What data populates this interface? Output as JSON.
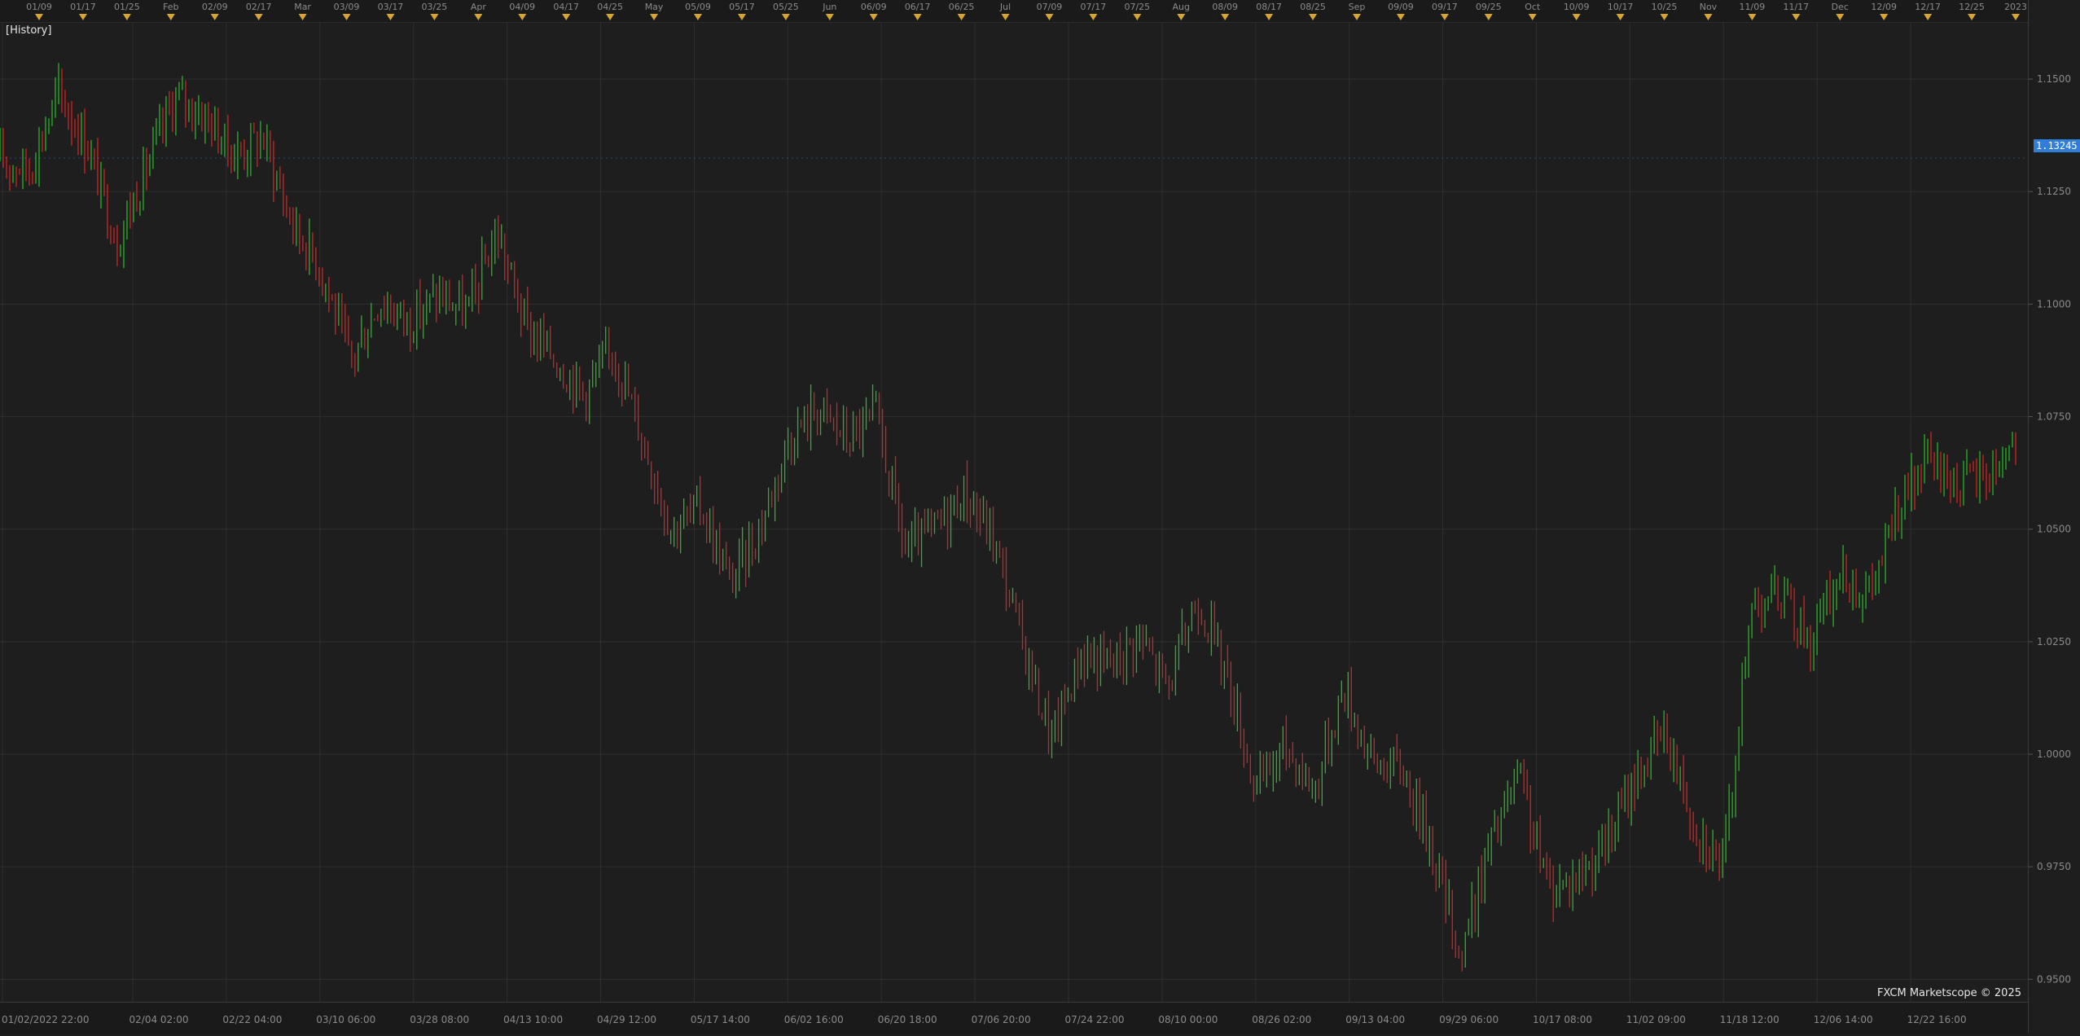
{
  "window": {
    "history_label": "[History]",
    "copyright": "FXCM Marketscope © 2025",
    "current_price": "1.13245"
  },
  "colors": {
    "background": "#1e1e1e",
    "grid": "#2e2e2e",
    "up_candle": "#22b822",
    "down_candle": "#d82020",
    "axis_text": "#8a8a8a",
    "marker": "#d7a531",
    "price_badge": "#2f7fd8"
  },
  "top_axis_labels": [
    "01/09",
    "01/17",
    "01/25",
    "Feb",
    "02/09",
    "02/17",
    "Mar",
    "03/09",
    "03/17",
    "03/25",
    "Apr",
    "04/09",
    "04/17",
    "04/25",
    "May",
    "05/09",
    "05/17",
    "05/25",
    "Jun",
    "06/09",
    "06/17",
    "06/25",
    "Jul",
    "07/09",
    "07/17",
    "07/25",
    "Aug",
    "08/09",
    "08/17",
    "08/25",
    "Sep",
    "09/09",
    "09/17",
    "09/25",
    "Oct",
    "10/09",
    "10/17",
    "10/25",
    "Nov",
    "11/09",
    "11/17",
    "Dec",
    "12/09",
    "12/17",
    "12/25",
    "2023"
  ],
  "chart_data": {
    "type": "line",
    "title": "",
    "xlabel": "",
    "ylabel": "",
    "ylim": [
      0.945,
      1.1625
    ],
    "grid": true,
    "y_ticks": [
      "1.1500",
      "1.1250",
      "1.1000",
      "1.0750",
      "1.0500",
      "1.0250",
      "1.0000",
      "0.9750",
      "0.9500"
    ],
    "y_tick_values": [
      1.15,
      1.125,
      1.1,
      1.075,
      1.05,
      1.025,
      1.0,
      0.975,
      0.95
    ],
    "x_tick_labels": [
      "01/02/2022 22:00",
      "02/04 02:00",
      "02/22 04:00",
      "03/10 06:00",
      "03/28 08:00",
      "04/13 10:00",
      "04/29 12:00",
      "05/17 14:00",
      "06/02 16:00",
      "06/20 18:00",
      "07/06 20:00",
      "07/24 22:00",
      "08/10 00:00",
      "08/26 02:00",
      "09/13 04:00",
      "09/29 06:00",
      "10/17 08:00",
      "11/02 09:00",
      "11/18 12:00",
      "12/06 14:00",
      "12/22 16:00"
    ],
    "series": [
      {
        "style": "candles",
        "x": [
          "2022-01-02",
          "2022-01-09",
          "2022-01-13",
          "2022-01-20",
          "2022-01-27",
          "2022-02-01",
          "2022-02-05",
          "2022-02-10",
          "2022-02-15",
          "2022-02-20",
          "2022-02-26",
          "2022-03-02",
          "2022-03-08",
          "2022-03-12",
          "2022-03-16",
          "2022-03-20",
          "2022-03-25",
          "2022-03-30",
          "2022-04-04",
          "2022-04-10",
          "2022-04-15",
          "2022-04-21",
          "2022-04-26",
          "2022-05-02",
          "2022-05-08",
          "2022-05-12",
          "2022-05-18",
          "2022-05-25",
          "2022-05-31",
          "2022-06-06",
          "2022-06-10",
          "2022-06-15",
          "2022-06-19",
          "2022-06-25",
          "2022-06-30",
          "2022-07-07",
          "2022-07-13",
          "2022-07-17",
          "2022-07-23",
          "2022-07-29",
          "2022-08-03",
          "2022-08-10",
          "2022-08-13",
          "2022-08-20",
          "2022-08-27",
          "2022-09-02",
          "2022-09-10",
          "2022-09-13",
          "2022-09-18",
          "2022-09-23",
          "2022-09-28",
          "2022-10-02",
          "2022-10-06",
          "2022-10-10",
          "2022-10-14",
          "2022-10-20",
          "2022-10-26",
          "2022-11-01",
          "2022-11-05",
          "2022-11-09",
          "2022-11-12",
          "2022-11-18",
          "2022-11-25",
          "2022-11-30",
          "2022-12-05",
          "2022-12-09",
          "2022-12-15",
          "2022-12-20",
          "2022-12-26",
          "2022-12-30"
        ],
        "values": [
          1.132,
          1.13,
          1.147,
          1.135,
          1.114,
          1.13,
          1.146,
          1.142,
          1.133,
          1.137,
          1.118,
          1.108,
          1.087,
          1.101,
          1.096,
          1.102,
          1.098,
          1.116,
          1.095,
          1.088,
          1.08,
          1.09,
          1.07,
          1.05,
          1.055,
          1.038,
          1.05,
          1.07,
          1.077,
          1.07,
          1.075,
          1.045,
          1.05,
          1.058,
          1.048,
          1.025,
          1.003,
          1.022,
          1.02,
          1.026,
          1.015,
          1.035,
          1.018,
          0.992,
          1.002,
          0.992,
          1.015,
          0.998,
          0.997,
          0.98,
          0.955,
          0.98,
          0.995,
          0.97,
          0.973,
          0.98,
          0.995,
          1.005,
          0.985,
          0.975,
          1.035,
          1.035,
          1.025,
          1.04,
          1.035,
          1.055,
          1.065,
          1.06,
          1.062,
          1.07
        ]
      }
    ]
  }
}
